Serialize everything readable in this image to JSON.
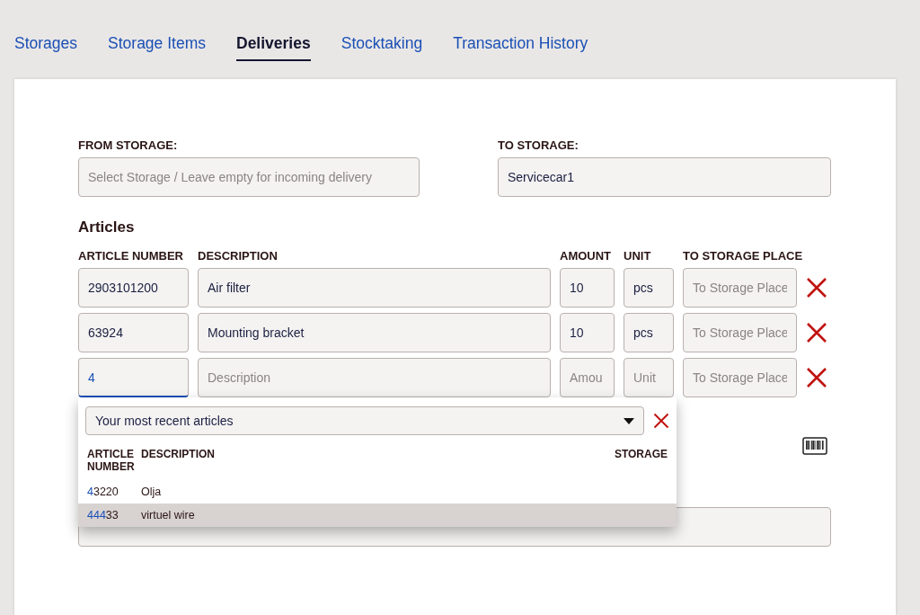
{
  "tabs": [
    {
      "label": "Storages",
      "selected": false
    },
    {
      "label": "Storage Items",
      "selected": false
    },
    {
      "label": "Deliveries",
      "selected": true
    },
    {
      "label": "Stocktaking",
      "selected": false
    },
    {
      "label": "Transaction History",
      "selected": false
    }
  ],
  "from_storage": {
    "label": "FROM STORAGE:",
    "placeholder": "Select Storage / Leave empty for incoming delivery"
  },
  "to_storage": {
    "label": "TO STORAGE:",
    "value": "Servicecar1"
  },
  "articles": {
    "title": "Articles",
    "columns": [
      "ARTICLE NUMBER",
      "DESCRIPTION",
      "AMOUNT",
      "UNIT",
      "TO STORAGE PLACE"
    ],
    "rows": [
      {
        "cells": [
          {
            "value": "2903101200",
            "focused": false
          },
          {
            "value": "Air filter",
            "focused": false
          },
          {
            "value": "10",
            "focused": false
          },
          {
            "value": "pcs",
            "focused": false
          },
          {
            "placeholder": "To Storage Place",
            "focused": false
          }
        ]
      },
      {
        "cells": [
          {
            "value": "63924",
            "focused": false
          },
          {
            "value": "Mounting bracket",
            "focused": false
          },
          {
            "value": "10",
            "focused": false
          },
          {
            "value": "pcs",
            "focused": false
          },
          {
            "placeholder": "To Storage Place",
            "focused": false
          }
        ]
      },
      {
        "cells": [
          {
            "value": "4",
            "focused": true
          },
          {
            "placeholder": "Description",
            "focused": false
          },
          {
            "placeholder": "Amou",
            "focused": false
          },
          {
            "placeholder": "Unit",
            "focused": false
          },
          {
            "placeholder": "To Storage Place",
            "focused": false
          }
        ]
      }
    ]
  },
  "suggestions": {
    "filter": "Your most recent articles",
    "columns": [
      "ARTICLE NUMBER",
      "DESCRIPTION",
      "STORAGE"
    ],
    "rows": [
      {
        "match": "4",
        "rest": "3220",
        "description": "Olja",
        "selected": false
      },
      {
        "match": "444",
        "rest": "33",
        "description": "virtuel wire",
        "selected": true
      }
    ]
  }
}
